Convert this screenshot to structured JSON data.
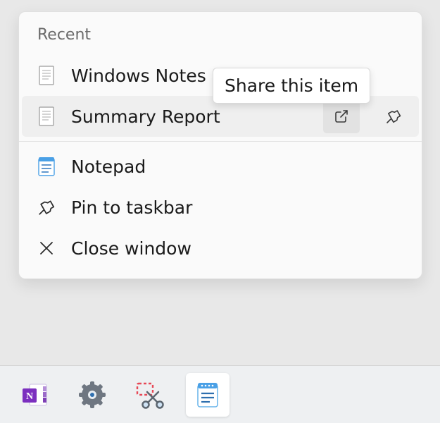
{
  "jumplist": {
    "section_header": "Recent",
    "recent": [
      {
        "label": "Windows Notes"
      },
      {
        "label": "Summary Report"
      }
    ],
    "app_label": "Notepad",
    "pin_label": "Pin to taskbar",
    "close_label": "Close window"
  },
  "tooltip": "Share this item",
  "taskbar": {
    "items": [
      {
        "name": "onenote"
      },
      {
        "name": "settings"
      },
      {
        "name": "snipping-tool"
      },
      {
        "name": "notepad",
        "active": true
      }
    ]
  }
}
